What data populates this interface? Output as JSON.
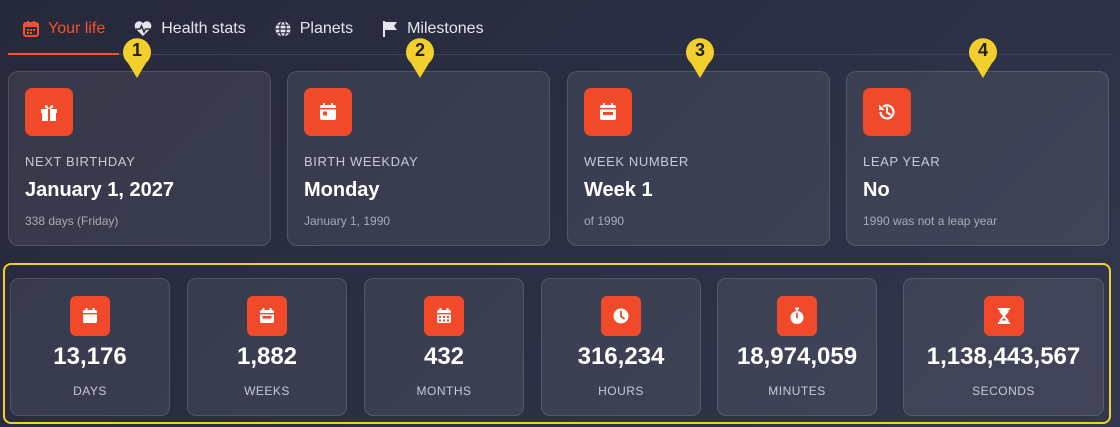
{
  "tabs": [
    {
      "label": "Your life",
      "icon": "calendar-icon",
      "active": true
    },
    {
      "label": "Health stats",
      "icon": "heartbeat-icon",
      "active": false
    },
    {
      "label": "Planets",
      "icon": "globe-icon",
      "active": false
    },
    {
      "label": "Milestones",
      "icon": "flag-icon",
      "active": false
    }
  ],
  "markers": [
    "1",
    "2",
    "3",
    "4"
  ],
  "cards": [
    {
      "label": "NEXT BIRTHDAY",
      "value": "January 1, 2027",
      "sub": "338 days (Friday)",
      "icon": "gift-icon"
    },
    {
      "label": "BIRTH WEEKDAY",
      "value": "Monday",
      "sub": "January 1, 1990",
      "icon": "calendar-day-icon"
    },
    {
      "label": "WEEK NUMBER",
      "value": "Week 1",
      "sub": "of 1990",
      "icon": "calendar-week-icon"
    },
    {
      "label": "LEAP YEAR",
      "value": "No",
      "sub": "1990 was not a leap year",
      "icon": "history-icon"
    }
  ],
  "stats": [
    {
      "value": "13,176",
      "label": "DAYS",
      "icon": "calendar-icon"
    },
    {
      "value": "1,882",
      "label": "WEEKS",
      "icon": "calendar-week-icon"
    },
    {
      "value": "432",
      "label": "MONTHS",
      "icon": "calendar-grid-icon"
    },
    {
      "value": "316,234",
      "label": "HOURS",
      "icon": "clock-icon"
    },
    {
      "value": "18,974,059",
      "label": "MINUTES",
      "icon": "stopwatch-icon"
    },
    {
      "value": "1,138,443,567",
      "label": "SECONDS",
      "icon": "hourglass-icon"
    }
  ],
  "colors": {
    "accent": "#f5512f",
    "icon_bg": "#f04a2a",
    "marker": "#f3cf2d",
    "highlight_border": "#f3cf2d"
  }
}
